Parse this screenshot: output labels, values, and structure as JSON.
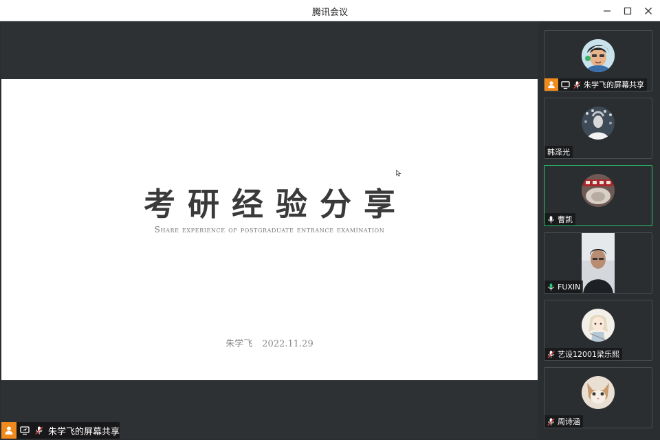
{
  "window": {
    "title": "腾讯会议"
  },
  "slide": {
    "title": "考研经验分享",
    "subtitle": "Share experience of postgraduate entrance examination",
    "author": "朱学飞",
    "date": "2022.11.29"
  },
  "share_label": {
    "name": "朱学飞的屏幕共享"
  },
  "participants": [
    {
      "name": "朱学飞的屏幕共享",
      "mic": "muted"
    },
    {
      "name": "韩泽光",
      "mic": "none"
    },
    {
      "name": "曹凯",
      "mic": "active"
    },
    {
      "name": "FUXIN",
      "mic": "active"
    },
    {
      "name": "艺设12001梁乐熙",
      "mic": "muted"
    },
    {
      "name": "周诗涵",
      "mic": "muted"
    }
  ],
  "colors": {
    "accent_green": "#28c76f",
    "host_orange": "#f08a1c",
    "muted_red": "#e0433a",
    "background": "#2b2e31"
  }
}
